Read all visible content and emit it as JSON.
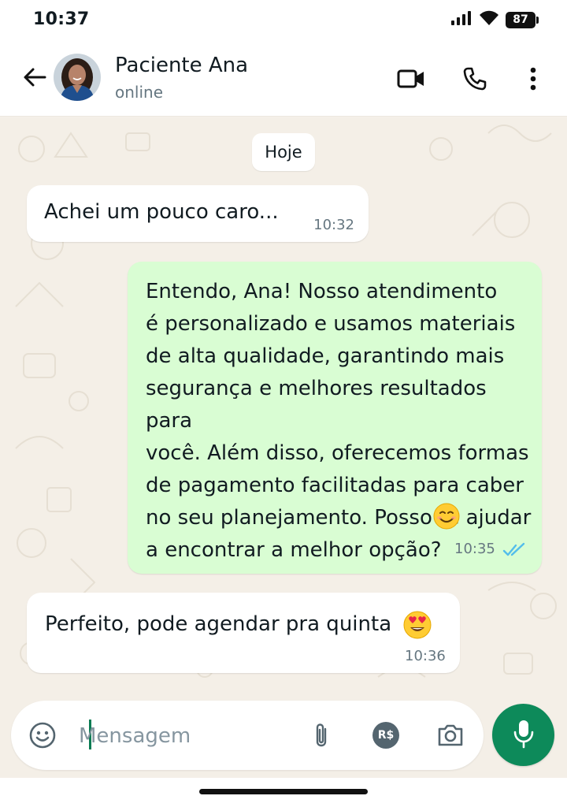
{
  "status_bar": {
    "time": "10:37",
    "battery": "87",
    "icons": [
      "signal-icon",
      "wifi-icon",
      "battery-icon"
    ]
  },
  "header": {
    "contact_name": "Paciente Ana",
    "contact_status": "online",
    "icons": [
      "back-arrow-icon",
      "video-call-icon",
      "phone-icon",
      "more-vert-icon"
    ]
  },
  "chat": {
    "date_chip": "Hoje",
    "messages": [
      {
        "direction": "incoming",
        "text": "Achei um pouco caro...",
        "time": "10:32"
      },
      {
        "direction": "outgoing",
        "text": "Entendo, Ana! Nosso atendimento\né personalizado e usamos materiais\nde alta qualidade, garantindo mais\nsegurança e melhores resultados para\nvocê. Além disso, oferecemos formas\nde pagamento facilitadas para caber\nno seu planejamento. Posso te ajudar\na encontrar a melhor opção?",
        "emoji": "smiling-face-emoji",
        "time": "10:35",
        "status": "read-double-check"
      },
      {
        "direction": "incoming",
        "text": "Perfeito, pode agendar pra quinta",
        "emoji": "heart-eyes-emoji",
        "time": "10:36"
      }
    ]
  },
  "composer": {
    "placeholder": "Mensagem",
    "value": "",
    "payment_badge": "R$",
    "icons": [
      "emoji-icon",
      "attach-icon",
      "payment-icon",
      "camera-icon",
      "mic-icon"
    ]
  },
  "colors": {
    "incoming_bubble": "#ffffff",
    "outgoing_bubble": "#d9fdd3",
    "read_check": "#53bdeb",
    "accent": "#0d8a5a",
    "chat_background": "#f4efe7"
  }
}
